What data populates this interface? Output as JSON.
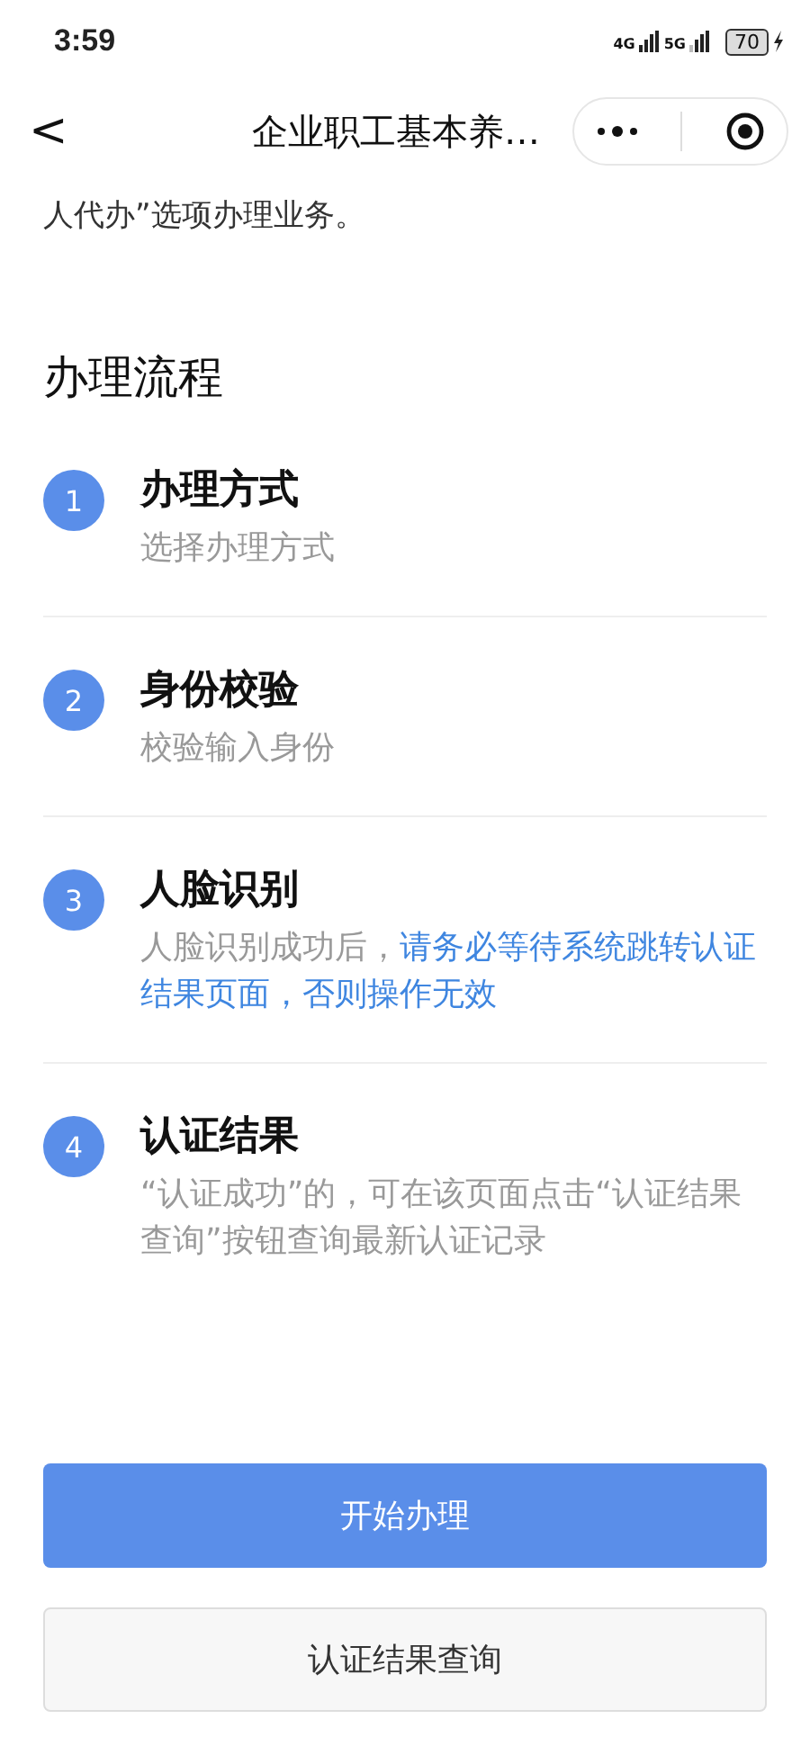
{
  "status_bar": {
    "time": "3:59",
    "network_1": "4G",
    "network_2": "5G",
    "battery": "70"
  },
  "nav_bar": {
    "back": "<",
    "title": "企业职工基本养…"
  },
  "intro": {
    "text": "人代办”选项办理业务。"
  },
  "section_title": "办理流程",
  "steps": [
    {
      "number": "1",
      "title": "办理方式",
      "description": "选择办理方式"
    },
    {
      "number": "2",
      "title": "身份校验",
      "description": "校验输入身份"
    },
    {
      "number": "3",
      "title": "人脸识别",
      "description": "人脸识别成功后，",
      "highlight": "请务必等待系统跳转认证结果页面，否则操作无效"
    },
    {
      "number": "4",
      "title": "认证结果",
      "description": "“认证成功”的，可在该页面点击“认证结果查询”按钮查询最新认证记录"
    }
  ],
  "buttons": [
    {
      "label": "开始办理",
      "kind": "primary"
    },
    {
      "label": "认证结果查询",
      "kind": "secondary"
    }
  ]
}
